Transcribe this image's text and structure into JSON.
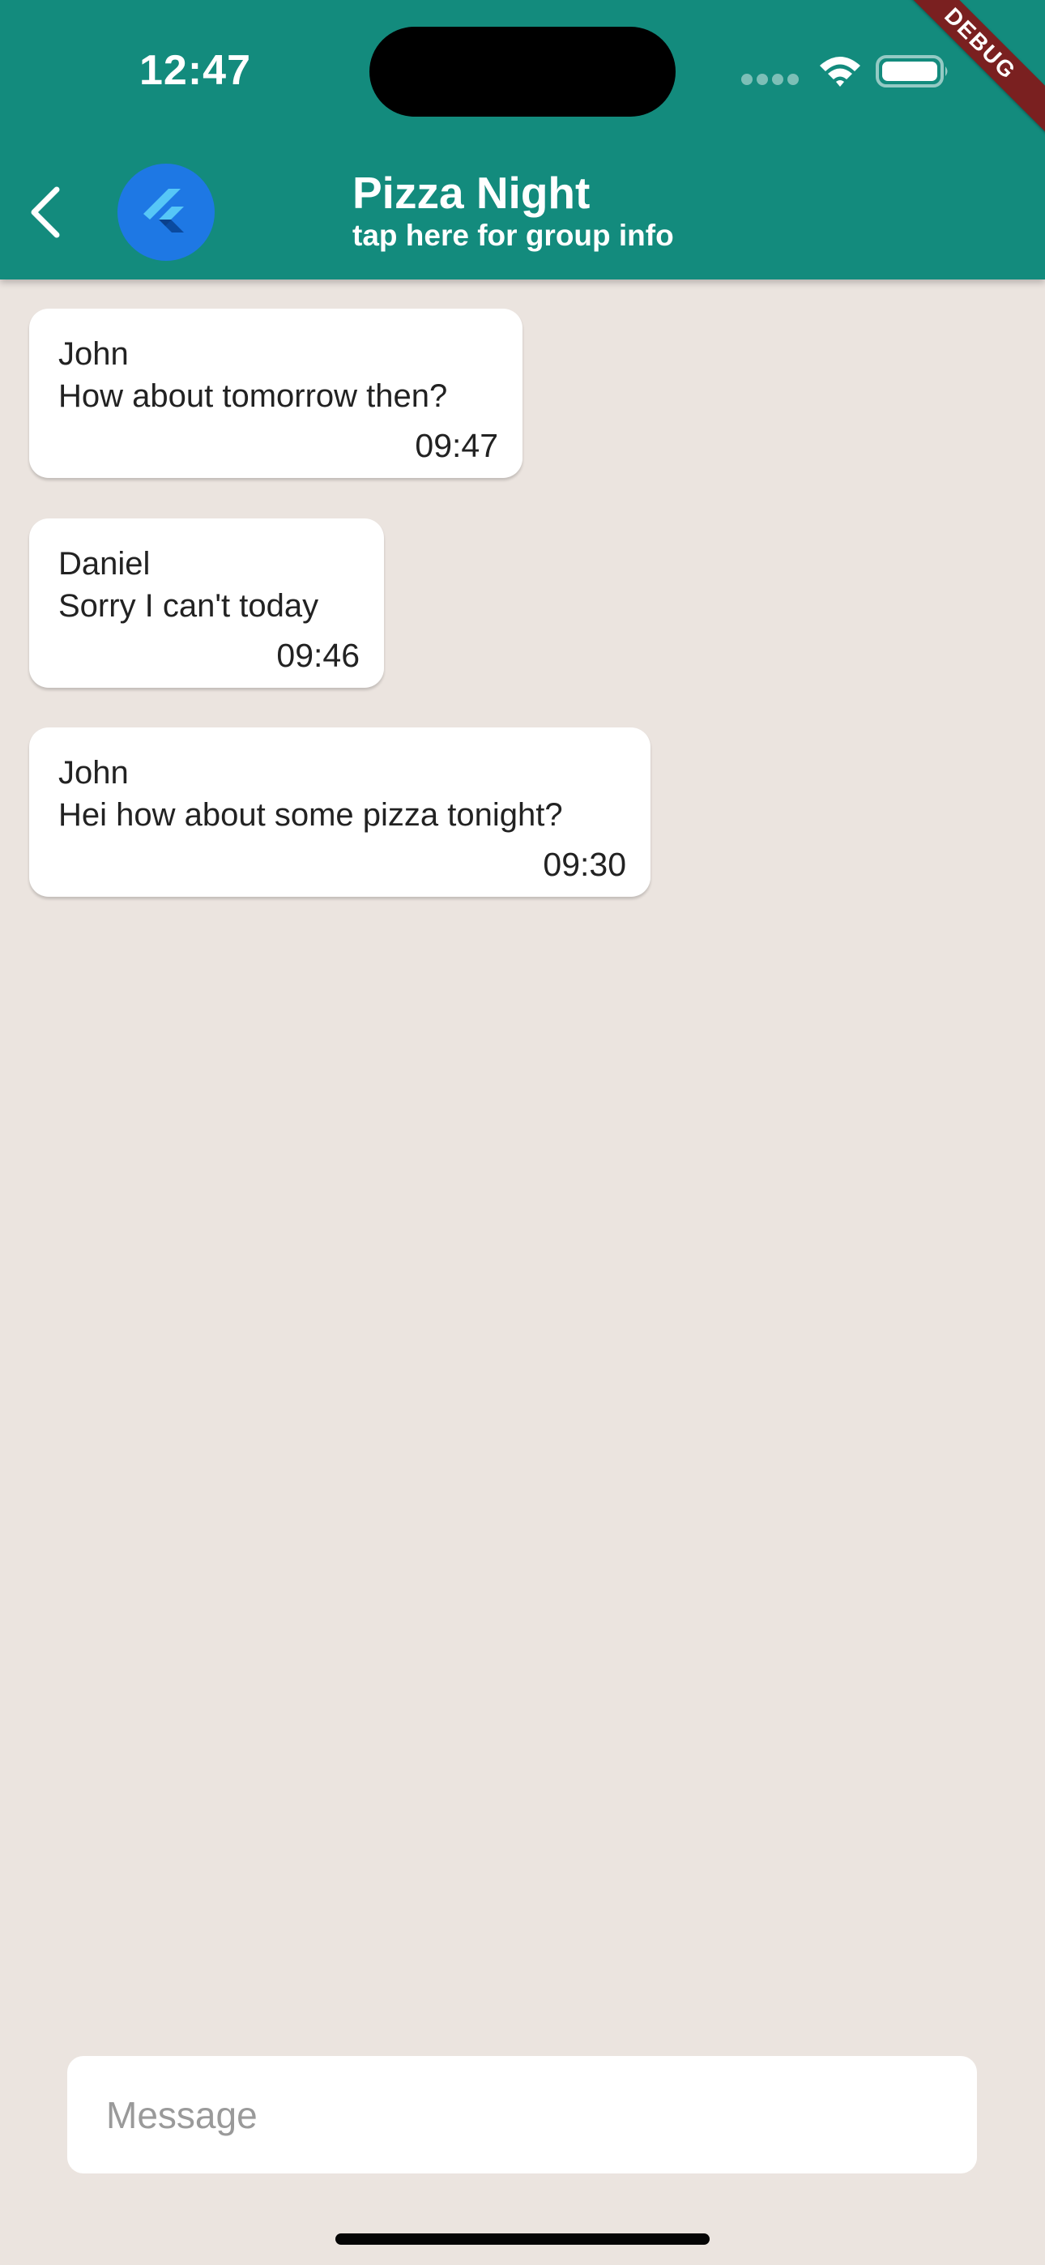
{
  "status_bar": {
    "time": "12:47",
    "icons": [
      "cellular-signal-icon",
      "wifi-icon",
      "battery-icon"
    ]
  },
  "debug_banner": "DEBUG",
  "header": {
    "title": "Pizza Night",
    "subtitle": "tap here for group info",
    "back_icon": "chevron-left-icon",
    "avatar_icon": "flutter-logo-icon"
  },
  "messages": [
    {
      "sender": "John",
      "text": "How about tomorrow then?",
      "time": "09:47"
    },
    {
      "sender": "Daniel",
      "text": "Sorry I can't today",
      "time": "09:46"
    },
    {
      "sender": "John",
      "text": "Hei how about some pizza tonight?",
      "time": "09:30"
    }
  ],
  "composer": {
    "placeholder": "Message",
    "value": ""
  },
  "colors": {
    "header_bg": "#138b7d",
    "chat_bg": "#ebe4df",
    "bubble_bg": "#ffffff",
    "avatar_bg": "#1e78e4",
    "debug_banner_bg": "#7a2020"
  }
}
